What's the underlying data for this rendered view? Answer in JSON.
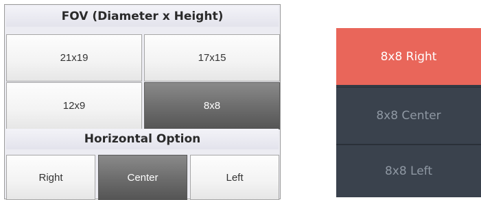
{
  "fov_panel": {
    "title": "FOV (Diameter x Height)",
    "options": [
      {
        "label": "21x19",
        "selected": false
      },
      {
        "label": "17x15",
        "selected": false
      },
      {
        "label": "12x9",
        "selected": false
      },
      {
        "label": "8x8",
        "selected": true
      }
    ],
    "horizontal_title": "Horizontal Option",
    "horizontal_options": [
      {
        "label": "Right",
        "selected": false
      },
      {
        "label": "Center",
        "selected": true
      },
      {
        "label": "Left",
        "selected": false
      }
    ]
  },
  "side_menu": {
    "items": [
      {
        "label": "8x8 Right",
        "selected": true
      },
      {
        "label": "8x8 Center",
        "selected": false
      },
      {
        "label": "8x8 Left",
        "selected": false
      }
    ],
    "colors": {
      "selected": "#e9665a",
      "background": "#3a424d",
      "text": "#8f98a3"
    }
  }
}
